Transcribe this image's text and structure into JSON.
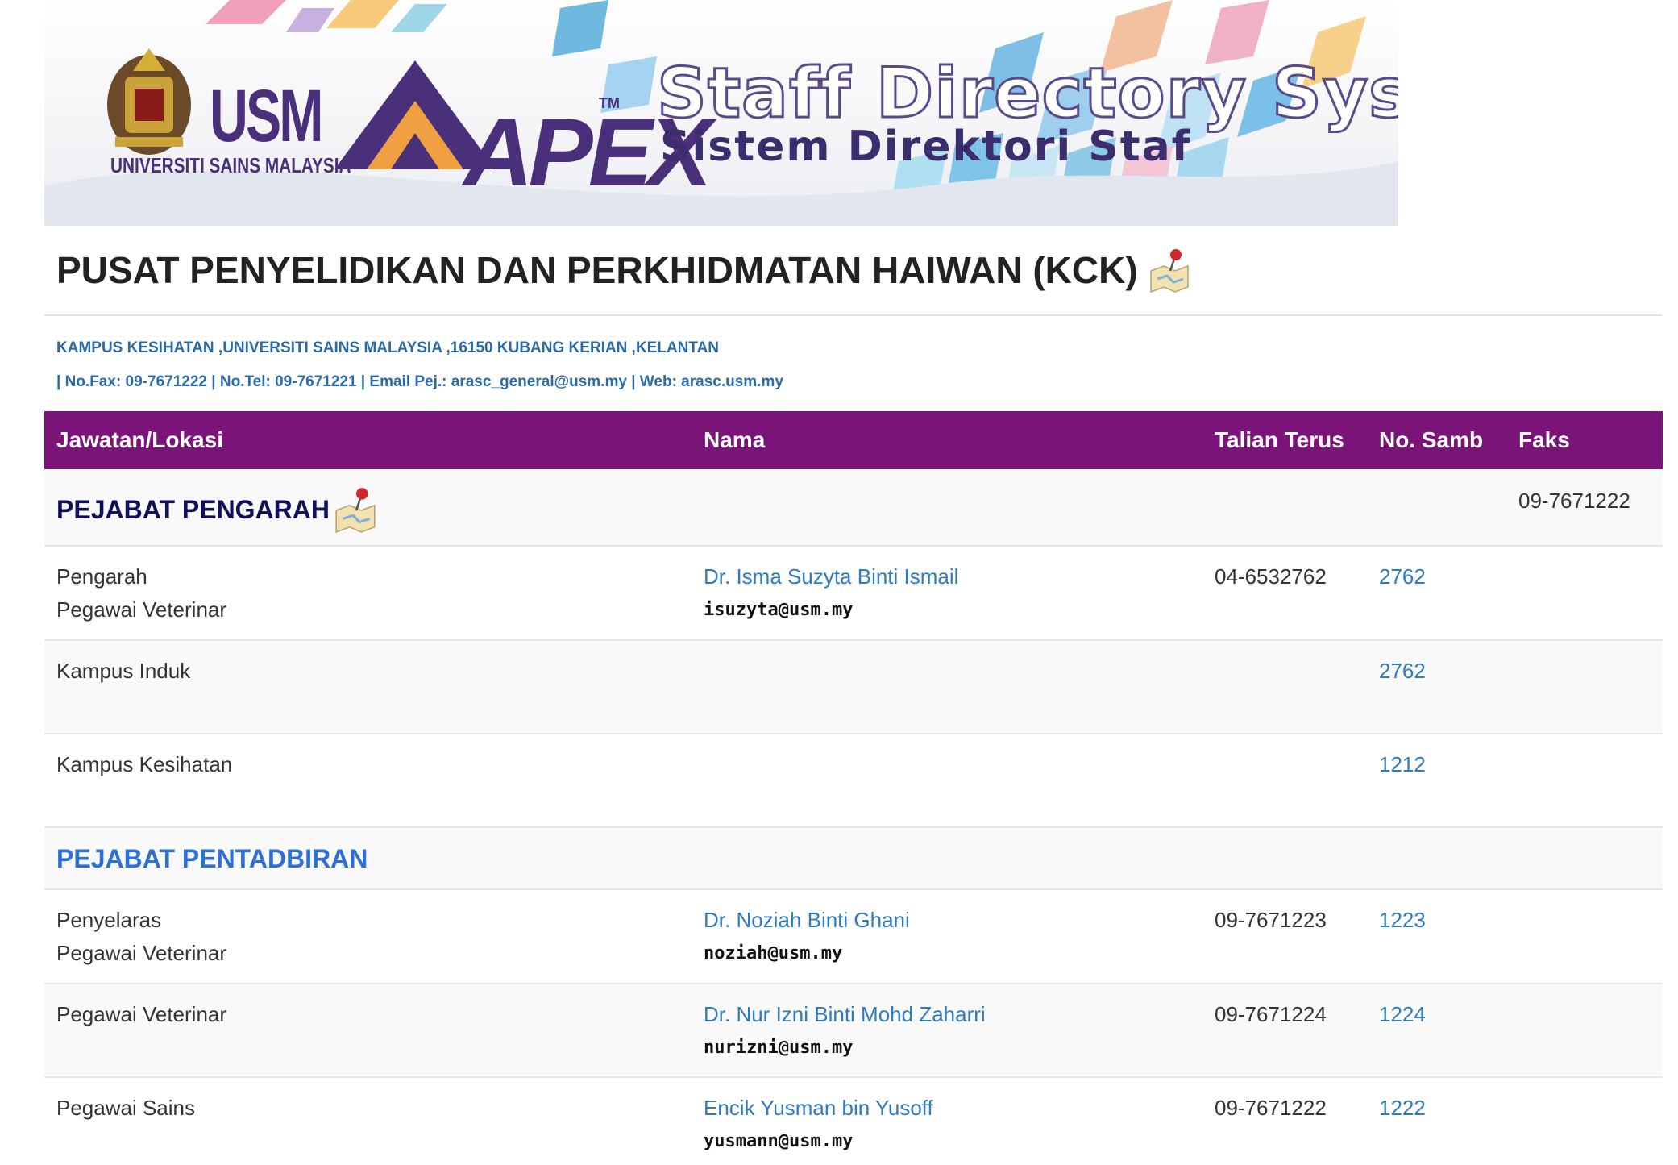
{
  "banner": {
    "usm_logo_text": "USM",
    "usm_subtitle": "UNIVERSITI SAINS MALAYSIA",
    "apex_logo_text": "APEX",
    "apex_tm": "TM",
    "title_en": "Staff Directory System",
    "title_ms": "Sistem Direktori Staf"
  },
  "department": {
    "title": "PUSAT PENYELIDIKAN DAN PERKHIDMATAN HAIWAN (KCK)",
    "address": "KAMPUS KESIHATAN ,UNIVERSITI SAINS MALAYSIA ,16150 KUBANG KERIAN ,KELANTAN",
    "contact": "| No.Fax: 09-7671222 | No.Tel: 09-7671221 | Email Pej.: arasc_general@usm.my | Web: arasc.usm.my"
  },
  "table": {
    "headers": {
      "jawatan": "Jawatan/Lokasi",
      "nama": "Nama",
      "talian": "Talian Terus",
      "samb": "No. Samb",
      "faks": "Faks"
    },
    "section_pengarah": {
      "title": "PEJABAT PENGARAH",
      "faks": "09-7671222"
    },
    "pengarah": {
      "jawatan1": "Pengarah",
      "jawatan2": "Pegawai Veterinar",
      "nama": "Dr. Isma Suzyta Binti Ismail",
      "email": "isuzyta@usm.my",
      "talian": "04-6532762",
      "samb": "2762"
    },
    "kampus_induk": {
      "jawatan": "Kampus Induk",
      "samb": "2762"
    },
    "kampus_kesihatan": {
      "jawatan": "Kampus Kesihatan",
      "samb": "1212"
    },
    "section_pentadbiran": {
      "title": "PEJABAT PENTADBIRAN"
    },
    "penyelaras": {
      "jawatan1": "Penyelaras",
      "jawatan2": "Pegawai Veterinar",
      "nama": "Dr. Noziah Binti Ghani",
      "email": "noziah@usm.my",
      "talian": "09-7671223",
      "samb": "1223"
    },
    "veterinar": {
      "jawatan": "Pegawai Veterinar",
      "nama": "Dr. Nur Izni Binti Mohd Zaharri",
      "email": "nurizni@usm.my",
      "talian": "09-7671224",
      "samb": "1224"
    },
    "sains": {
      "jawatan": "Pegawai Sains",
      "nama": "Encik Yusman bin Yusoff",
      "email": "yusmann@usm.my",
      "talian": "09-7671222",
      "samb": "1222"
    }
  }
}
